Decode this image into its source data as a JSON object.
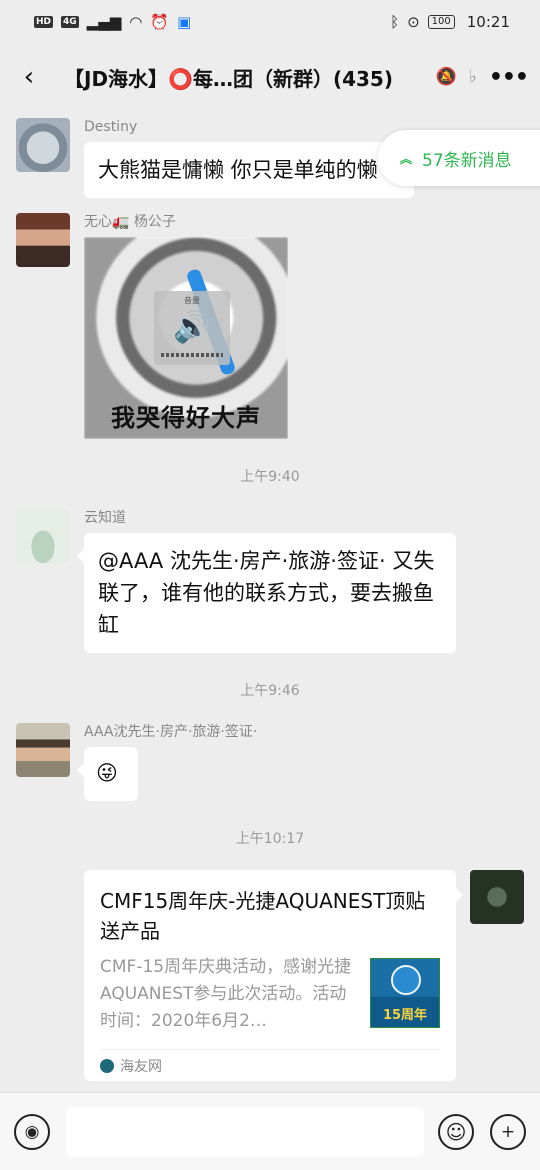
{
  "status_bar": {
    "left_chips": [
      "HD",
      "4G"
    ],
    "signal_icon": "signal-bars",
    "wifi_icon": "wifi",
    "alarm_icon": "alarm-clock",
    "app_icon": "alipay",
    "bluetooth_icon": "bluetooth",
    "location_icon": "location-pin",
    "battery": "100",
    "time": "10:21"
  },
  "header": {
    "title": "【JD海水】⭕每…团（新群）(435)",
    "mute_icon": "bell-off",
    "ear_icon": "ear",
    "more_icon": "more-dots"
  },
  "new_messages": {
    "label": "57条新消息"
  },
  "messages": [
    {
      "sender": "Destiny",
      "text": "大熊猫是慵懒 你只是单纯的懒"
    },
    {
      "sender": "无心🚛 杨公子",
      "sticker": {
        "overlay_title": "音量",
        "caption": "我哭得好大声"
      }
    },
    {
      "sender": "云知道",
      "text": "@AAA 沈先生·房产·旅游·签证· 又失联了，谁有他的联系方式，要去搬鱼缸"
    },
    {
      "sender": "AAA沈先生·房产·旅游·签证·",
      "text": "😜"
    }
  ],
  "time_separators": [
    "上午9:40",
    "上午9:46",
    "上午10:17"
  ],
  "link_card": {
    "title": "CMF15周年庆-光捷AQUANEST顶贴送产品",
    "description": "CMF-15周年庆典活动，感谢光捷AQUANEST参与此次活动。活动时间：2020年6月2…",
    "thumb_text": "15周年",
    "source": "海友网"
  },
  "input_bar": {
    "voice_icon": "voice",
    "emoji_icon": "smiley",
    "plus_icon": "plus"
  }
}
